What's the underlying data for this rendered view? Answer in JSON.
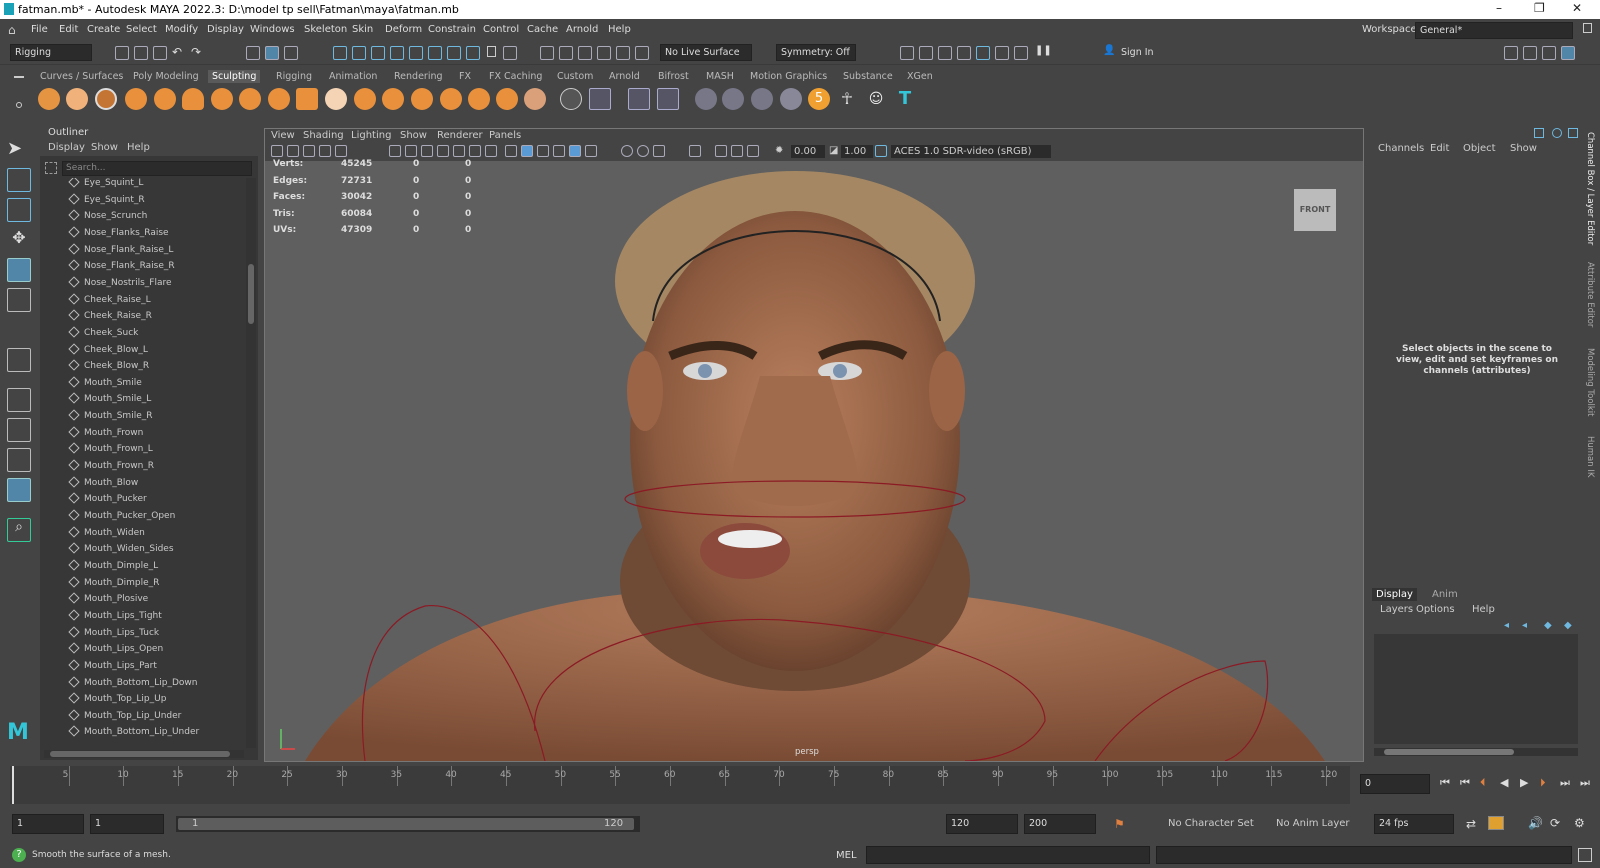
{
  "window": {
    "title": "fatman.mb* - Autodesk MAYA 2022.3: D:\\model tp sell\\Fatman\\maya\\fatman.mb",
    "minimize": "–",
    "maximize": "❐",
    "close": "✕"
  },
  "menubar": [
    "File",
    "Edit",
    "Create",
    "Select",
    "Modify",
    "Display",
    "Windows",
    "Skeleton",
    "Skin",
    "Deform",
    "Constrain",
    "Control",
    "Cache",
    "Arnold",
    "Help"
  ],
  "workspace": {
    "label": "Workspace:",
    "value": "General*"
  },
  "statusline": {
    "menuset": "Rigging",
    "live_surface": "No Live Surface",
    "symmetry": "Symmetry: Off",
    "sign_in": "Sign In"
  },
  "shelf_tabs": [
    "Curves / Surfaces",
    "Poly Modeling",
    "Sculpting",
    "Rigging",
    "Animation",
    "Rendering",
    "FX",
    "FX Caching",
    "Custom",
    "Arnold",
    "Bifrost",
    "MASH",
    "Motion Graphics",
    "Substance",
    "XGen"
  ],
  "shelf_active": "Sculpting",
  "outliner": {
    "title": "Outliner",
    "menus": [
      "Display",
      "Show",
      "Help"
    ],
    "search_placeholder": "Search...",
    "items": [
      "Eye_Squint_L",
      "Eye_Squint_R",
      "Nose_Scrunch",
      "Nose_Flanks_Raise",
      "Nose_Flank_Raise_L",
      "Nose_Flank_Raise_R",
      "Nose_Nostrils_Flare",
      "Cheek_Raise_L",
      "Cheek_Raise_R",
      "Cheek_Suck",
      "Cheek_Blow_L",
      "Cheek_Blow_R",
      "Mouth_Smile",
      "Mouth_Smile_L",
      "Mouth_Smile_R",
      "Mouth_Frown",
      "Mouth_Frown_L",
      "Mouth_Frown_R",
      "Mouth_Blow",
      "Mouth_Pucker",
      "Mouth_Pucker_Open",
      "Mouth_Widen",
      "Mouth_Widen_Sides",
      "Mouth_Dimple_L",
      "Mouth_Dimple_R",
      "Mouth_Plosive",
      "Mouth_Lips_Tight",
      "Mouth_Lips_Tuck",
      "Mouth_Lips_Open",
      "Mouth_Lips_Part",
      "Mouth_Bottom_Lip_Down",
      "Mouth_Top_Lip_Up",
      "Mouth_Top_Lip_Under",
      "Mouth_Bottom_Lip_Under"
    ]
  },
  "viewport": {
    "menus": [
      "View",
      "Shading",
      "Lighting",
      "Show",
      "Renderer",
      "Panels"
    ],
    "exposure": "0.00",
    "gamma": "1.00",
    "color_space": "ACES 1.0 SDR-video (sRGB)",
    "hud": [
      {
        "label": "Verts:",
        "v1": "45245",
        "v2": "0",
        "v3": "0"
      },
      {
        "label": "Edges:",
        "v1": "72731",
        "v2": "0",
        "v3": "0"
      },
      {
        "label": "Faces:",
        "v1": "30042",
        "v2": "0",
        "v3": "0"
      },
      {
        "label": "Tris:",
        "v1": "60084",
        "v2": "0",
        "v3": "0"
      },
      {
        "label": "UVs:",
        "v1": "47309",
        "v2": "0",
        "v3": "0"
      }
    ],
    "view_cube": "FRONT",
    "camera": "persp"
  },
  "channelbox": {
    "menus": [
      "Channels",
      "Edit",
      "Object",
      "Show"
    ],
    "empty_msg": "Select objects in the scene to view, edit and set keyframes on channels (attributes)",
    "layer_tabs": [
      "Display",
      "Anim"
    ],
    "layer_menus": [
      "Layers",
      "Options",
      "Help"
    ]
  },
  "vertical_tabs": [
    "Channel Box / Layer Editor",
    "Attribute Editor",
    "Modeling Toolkit",
    "Human IK"
  ],
  "timeline": {
    "ticks": [
      "5",
      "10",
      "15",
      "20",
      "25",
      "30",
      "35",
      "40",
      "45",
      "50",
      "55",
      "60",
      "65",
      "70",
      "75",
      "80",
      "85",
      "90",
      "95",
      "100",
      "105",
      "110",
      "115",
      "120"
    ],
    "current_frame": "0"
  },
  "range": {
    "start": "1",
    "anim_start": "1",
    "slider_start": "1",
    "slider_end": "120",
    "end": "120",
    "anim_end": "200",
    "char_set": "No Character Set",
    "anim_layer": "No Anim Layer",
    "fps": "24 fps"
  },
  "helpline": {
    "message": "Smooth the surface of a mesh.",
    "mel": "MEL"
  }
}
